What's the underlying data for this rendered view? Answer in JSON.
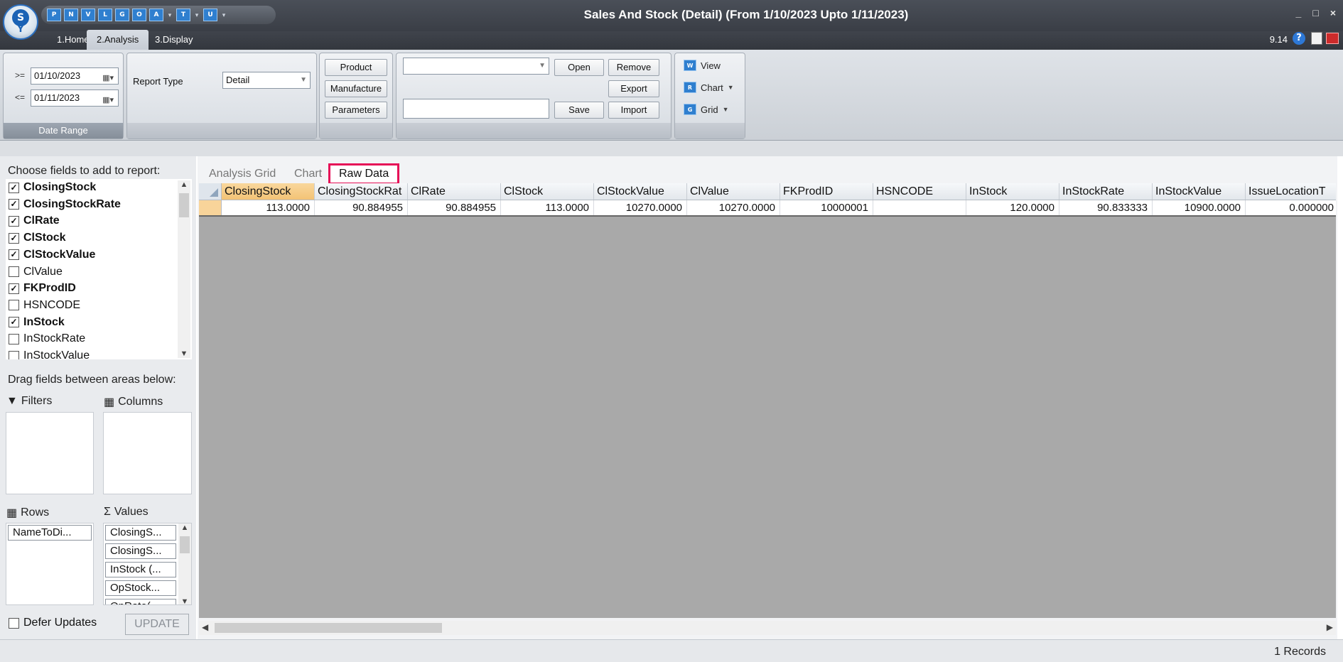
{
  "window": {
    "title": "Sales And Stock (Detail)  (From 1/10/2023 Upto 1/11/2023)",
    "version": "9.14",
    "controls": [
      "_",
      "□",
      "×"
    ]
  },
  "app_logo": {
    "letter": "S",
    "sprout": "Y"
  },
  "quick_access": [
    "P",
    "N",
    "V",
    "L",
    "G",
    "O",
    "A",
    "T",
    "U"
  ],
  "ribbon_tabs": [
    "1.Home",
    "2.Analysis",
    "3.Display"
  ],
  "date_range": {
    "ge_label": ">=",
    "le_label": "<=",
    "from": "01/10/2023",
    "to": "01/11/2023",
    "group_label": "Date Range"
  },
  "report_type": {
    "label": "Report Type",
    "value": "Detail"
  },
  "buttons": {
    "product": "Product",
    "manufacture": "Manufacture",
    "parameters": "Parameters",
    "open": "Open",
    "remove": "Remove",
    "export": "Export",
    "save": "Save",
    "import": "Import"
  },
  "view_menu": {
    "view": "View",
    "chart": "Chart",
    "grid": "Grid"
  },
  "field_list": {
    "title": "Choose fields to add to report:",
    "items": [
      {
        "label": "ClosingStock",
        "checked": true
      },
      {
        "label": "ClosingStockRate",
        "checked": true
      },
      {
        "label": "ClRate",
        "checked": true
      },
      {
        "label": "ClStock",
        "checked": true
      },
      {
        "label": "ClStockValue",
        "checked": true
      },
      {
        "label": "ClValue",
        "checked": false
      },
      {
        "label": "FKProdID",
        "checked": true
      },
      {
        "label": "HSNCODE",
        "checked": false
      },
      {
        "label": "InStock",
        "checked": true
      },
      {
        "label": "InStockRate",
        "checked": false
      },
      {
        "label": "InStockValue",
        "checked": false
      }
    ]
  },
  "areas": {
    "drag_title": "Drag fields between areas below:",
    "filters": "Filters",
    "columns": "Columns",
    "rows": "Rows",
    "values": "Values",
    "rows_items": [
      "NameToDi..."
    ],
    "values_items": [
      "ClosingS...",
      "ClosingS...",
      "InStock (...",
      "OpStock...",
      "OpRate(..."
    ]
  },
  "defer": {
    "label": "Defer Updates",
    "checked": false,
    "update": "UPDATE"
  },
  "view_tabs": [
    "Analysis Grid",
    "Chart",
    "Raw Data"
  ],
  "grid": {
    "columns": [
      "ClosingStock",
      "ClosingStockRat",
      "ClRate",
      "ClStock",
      "ClStockValue",
      "ClValue",
      "FKProdID",
      "HSNCODE",
      "InStock",
      "InStockRate",
      "InStockValue",
      "IssueLocationT"
    ],
    "rows": [
      [
        "113.0000",
        "90.884955",
        "90.884955",
        "113.0000",
        "10270.0000",
        "10270.0000",
        "10000001",
        "",
        "120.0000",
        "90.833333",
        "10900.0000",
        "0.000000"
      ]
    ]
  },
  "status": {
    "records": "1 Records"
  },
  "colors": {
    "highlight": "#e60f57",
    "selected_header": "#f3c375",
    "grid_bg": "#a9a9a9"
  }
}
